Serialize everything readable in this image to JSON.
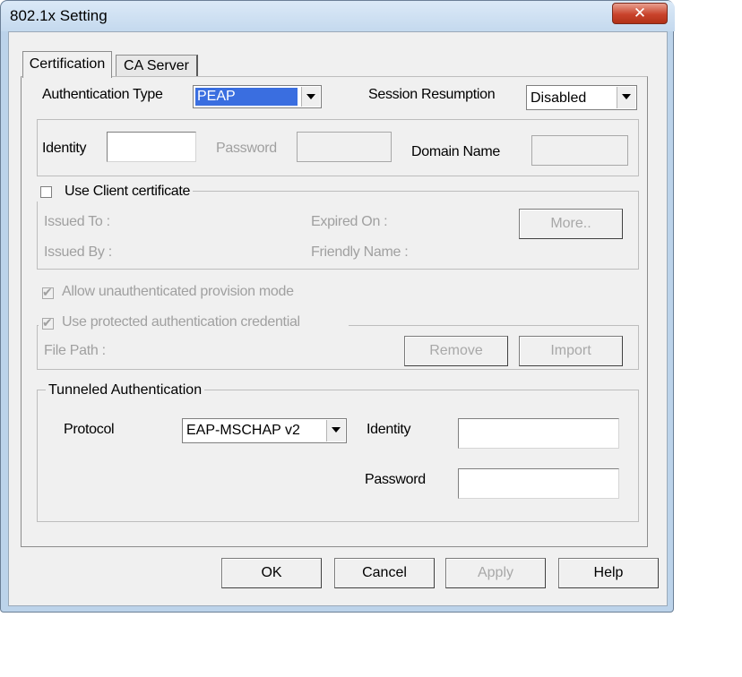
{
  "window": {
    "title": "802.1x Setting",
    "close_glyph": "✕"
  },
  "tabs": [
    {
      "label": "Certification"
    },
    {
      "label": "CA Server"
    }
  ],
  "auth": {
    "type_label": "Authentication Type",
    "type_value": "PEAP",
    "session_label": "Session Resumption",
    "session_value": "Disabled"
  },
  "credentials": {
    "identity_label": "Identity",
    "identity_value": "",
    "password_label": "Password",
    "password_value": "",
    "domain_label": "Domain Name",
    "domain_value": ""
  },
  "client_cert": {
    "checkbox_label": "Use Client certificate",
    "checked": false,
    "issued_to": "Issued To :",
    "issued_by": "Issued By :",
    "expired_on": "Expired On :",
    "friendly_name": "Friendly Name :",
    "more_button": "More.."
  },
  "provision": {
    "allow_label": "Allow unauthenticated provision mode",
    "protected_label": "Use protected authentication credential",
    "file_path_label": "File Path :",
    "remove_button": "Remove",
    "import_button": "Import"
  },
  "tunneled": {
    "legend": "Tunneled Authentication",
    "protocol_label": "Protocol",
    "protocol_value": "EAP-MSCHAP v2",
    "identity_label": "Identity",
    "identity_value": "",
    "password_label": "Password",
    "password_value": ""
  },
  "footer": {
    "ok": "OK",
    "cancel": "Cancel",
    "apply": "Apply",
    "help": "Help"
  }
}
